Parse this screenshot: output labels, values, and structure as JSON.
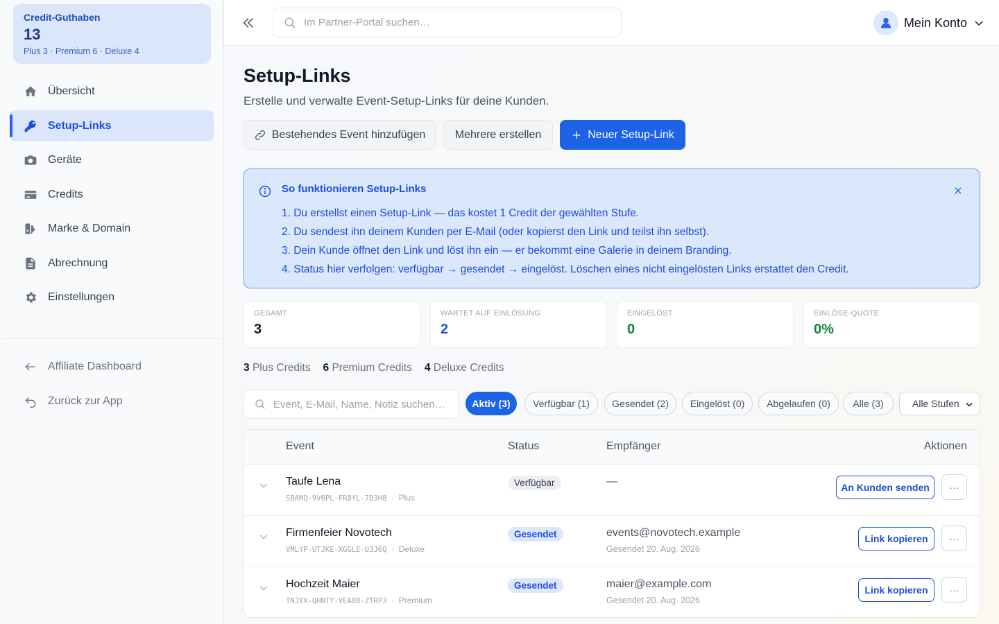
{
  "sidebar": {
    "credit": {
      "label": "Credit-Guthaben",
      "total": "13",
      "detail": "Plus 3 · Premium 6 · Deluxe 4"
    },
    "items": [
      {
        "label": "Übersicht",
        "icon": "home-icon"
      },
      {
        "label": "Setup-Links",
        "icon": "key-icon",
        "active": true
      },
      {
        "label": "Geräte",
        "icon": "camera-icon"
      },
      {
        "label": "Credits",
        "icon": "card-icon"
      },
      {
        "label": "Marke & Domain",
        "icon": "brand-icon"
      },
      {
        "label": "Abrechnung",
        "icon": "document-icon"
      },
      {
        "label": "Einstellungen",
        "icon": "gear-icon"
      }
    ],
    "footer": [
      {
        "label": "Affiliate Dashboard",
        "icon": "arrow-left-icon"
      },
      {
        "label": "Zurück zur App",
        "icon": "undo-icon"
      }
    ]
  },
  "header": {
    "search_placeholder": "Im Partner-Portal suchen…",
    "account_label": "Mein Konto"
  },
  "page": {
    "title": "Setup-Links",
    "subtitle": "Erstelle und verwalte Event-Setup-Links für deine Kunden.",
    "buttons": {
      "add_existing": "Bestehendes Event hinzufügen",
      "bulk_create": "Mehrere erstellen",
      "new_link": "Neuer Setup-Link"
    }
  },
  "info": {
    "title": "So funktionieren Setup-Links",
    "steps": [
      "1. Du erstellst einen Setup-Link — das kostet 1 Credit der gewählten Stufe.",
      "2. Du sendest ihn deinem Kunden per E-Mail (oder kopierst den Link und teilst ihn selbst).",
      "3. Dein Kunde öffnet den Link und löst ihn ein — er bekommt eine Galerie in deinem Branding.",
      "4. Status hier verfolgen: verfügbar → gesendet → eingelöst. Löschen eines nicht eingelösten Links erstattet den Credit."
    ]
  },
  "stats": [
    {
      "label": "Gesamt",
      "value": "3",
      "color": "#111827"
    },
    {
      "label": "Wartet auf Einlösung",
      "value": "2",
      "color": "#1d4ed8"
    },
    {
      "label": "Eingelöst",
      "value": "0",
      "color": "#15803d"
    },
    {
      "label": "Einlöse-Quote",
      "value": "0%",
      "color": "#15803d"
    }
  ],
  "credit_summary": [
    {
      "count": "3",
      "label": "Plus Credits"
    },
    {
      "count": "6",
      "label": "Premium Credits"
    },
    {
      "count": "4",
      "label": "Deluxe Credits"
    }
  ],
  "filters": {
    "search_placeholder": "Event, E-Mail, Name, Notiz suchen…",
    "chips": [
      "Aktiv (3)",
      "Verfügbar (1)",
      "Gesendet (2)",
      "Eingelöst (0)",
      "Abgelaufen (0)",
      "Alle (3)"
    ],
    "active_chip": "Aktiv (3)",
    "tier_select": "Alle Stufen"
  },
  "table": {
    "headers": {
      "event": "Event",
      "status": "Status",
      "recipient": "Empfänger",
      "actions": "Aktionen"
    },
    "rows": [
      {
        "name": "Taufe Lena",
        "code": "SBAMQ-9V6PL-FR8YL-7D3H8",
        "tier": "Plus",
        "status": "Verfügbar",
        "status_type": "avail",
        "recipient": "—",
        "recipient_sub": "",
        "action": "An Kunden senden"
      },
      {
        "name": "Firmenfeier Novotech",
        "code": "VMLYP-UTJKE-XGGLE-U3J6Q",
        "tier": "Deluxe",
        "status": "Gesendet",
        "status_type": "sent",
        "recipient": "events@novotech.example",
        "recipient_sub": "Gesendet 20. Aug. 2026",
        "action": "Link kopieren"
      },
      {
        "name": "Hochzeit Maier",
        "code": "TNJYX-QHNTY-VEA88-ZTRP3",
        "tier": "Premium",
        "status": "Gesendet",
        "status_type": "sent",
        "recipient": "maier@example.com",
        "recipient_sub": "Gesendet 20. Aug. 2026",
        "action": "Link kopieren"
      }
    ],
    "more_label": "···"
  }
}
